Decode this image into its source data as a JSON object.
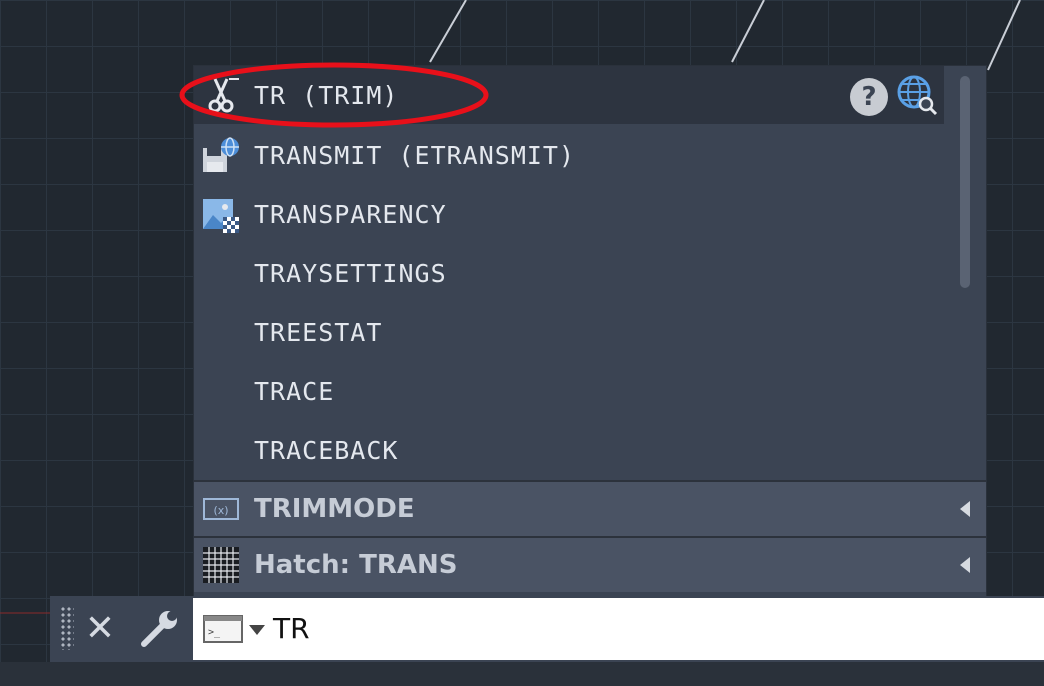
{
  "autocomplete": {
    "selected": {
      "label": "TR (TRIM)",
      "icon": "scissors-icon"
    },
    "items": [
      {
        "label": "TRANSMIT (ETRANSMIT)",
        "icon": "etransmit-icon"
      },
      {
        "label": "TRANSPARENCY",
        "icon": "transparency-icon"
      },
      {
        "label": "TRAYSETTINGS",
        "icon": ""
      },
      {
        "label": "TREESTAT",
        "icon": ""
      },
      {
        "label": "TRACE",
        "icon": ""
      },
      {
        "label": "TRACEBACK",
        "icon": ""
      }
    ],
    "sections": [
      {
        "label": "TRIMMODE",
        "icon": "system-variable-icon"
      },
      {
        "label": "Hatch: TRANS",
        "icon": "hatch-pattern-icon"
      }
    ],
    "help_glyph": "?",
    "highlight_color": "#e8101a"
  },
  "command_line": {
    "close_glyph": "✕",
    "input_value": "TR"
  }
}
